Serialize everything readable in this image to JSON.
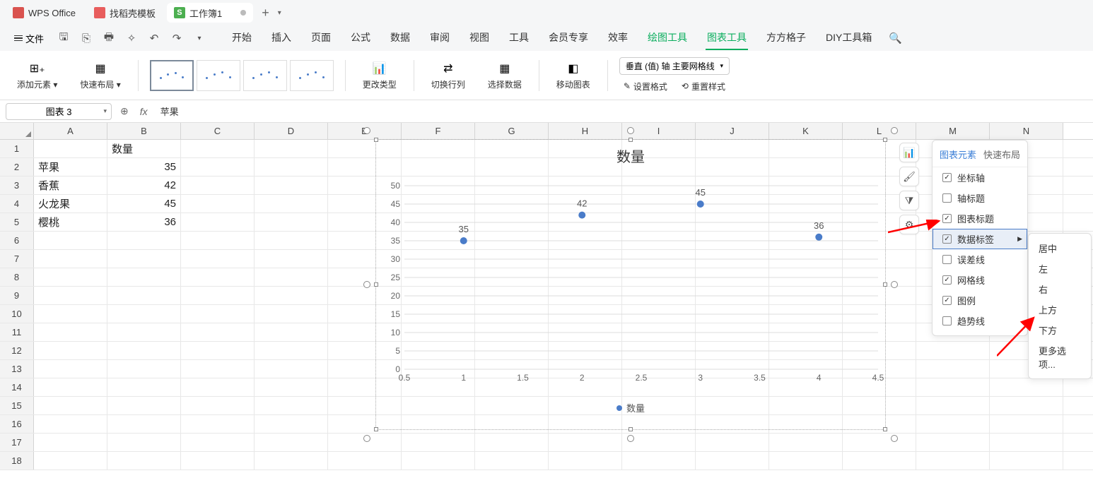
{
  "titlebar": {
    "app_name": "WPS Office",
    "tab_template": "找稻壳模板",
    "tab_workbook": "工作簿1",
    "sheet_badge": "S"
  },
  "menubar": {
    "file": "文件",
    "tabs": [
      "开始",
      "插入",
      "页面",
      "公式",
      "数据",
      "审阅",
      "视图",
      "工具",
      "会员专享",
      "效率",
      "绘图工具",
      "图表工具",
      "方方格子",
      "DIY工具箱"
    ]
  },
  "ribbon": {
    "add_element": "添加元素",
    "quick_layout": "快速布局",
    "change_type": "更改类型",
    "switch_rowcol": "切换行列",
    "select_data": "选择数据",
    "move_chart": "移动图表",
    "gridlines_dropdown": "垂直 (值) 轴 主要网格线",
    "set_format": "设置格式",
    "reset_style": "重置样式"
  },
  "formula_bar": {
    "name_box": "图表 3",
    "formula": "苹果"
  },
  "columns": [
    "A",
    "B",
    "C",
    "D",
    "E",
    "F",
    "G",
    "H",
    "I",
    "J",
    "K",
    "L",
    "M",
    "N"
  ],
  "sheet": {
    "header_qty": "数量",
    "rows": [
      {
        "label": "苹果",
        "value": "35"
      },
      {
        "label": "香蕉",
        "value": "42"
      },
      {
        "label": "火龙果",
        "value": "45"
      },
      {
        "label": "樱桃",
        "value": "36"
      }
    ]
  },
  "chart_data": {
    "type": "scatter",
    "title": "数量",
    "x": [
      1,
      2,
      3,
      4
    ],
    "values": [
      35,
      42,
      45,
      36
    ],
    "xlabel": "",
    "ylabel": "",
    "xlim": [
      0.5,
      4.5
    ],
    "ylim": [
      0,
      50
    ],
    "xticks": [
      0.5,
      1,
      1.5,
      2,
      2.5,
      3,
      3.5,
      4,
      4.5
    ],
    "yticks": [
      0,
      5,
      10,
      15,
      20,
      25,
      30,
      35,
      40,
      45,
      50
    ],
    "legend": "数量",
    "data_labels": true
  },
  "side_buttons": [
    "chart-element-icon",
    "brush-icon",
    "filter-icon",
    "settings-icon"
  ],
  "elements_popup": {
    "tabs": {
      "elements": "图表元素",
      "quick": "快速布局"
    },
    "items": [
      {
        "label": "坐标轴",
        "checked": true
      },
      {
        "label": "轴标题",
        "checked": false
      },
      {
        "label": "图表标题",
        "checked": true
      },
      {
        "label": "数据标签",
        "checked": true,
        "highlighted": true,
        "has_arrow": true
      },
      {
        "label": "误差线",
        "checked": false
      },
      {
        "label": "网格线",
        "checked": true
      },
      {
        "label": "图例",
        "checked": true
      },
      {
        "label": "趋势线",
        "checked": false
      }
    ]
  },
  "submenu": [
    "居中",
    "左",
    "右",
    "上方",
    "下方",
    "更多选项..."
  ]
}
